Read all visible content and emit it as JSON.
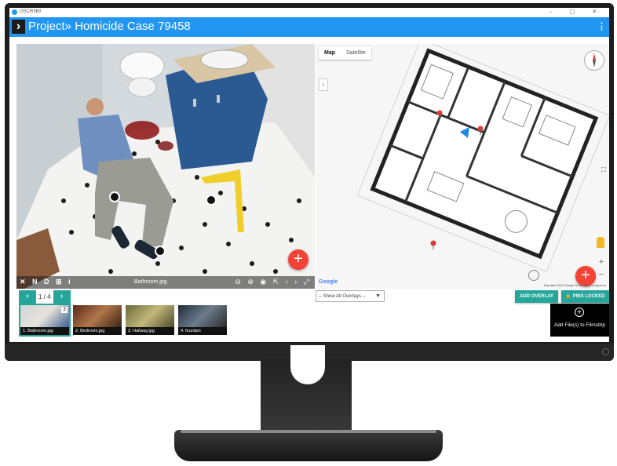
{
  "window": {
    "app_name": "OSCR360",
    "controls": "– ▢ ✕"
  },
  "header": {
    "title": "Project» Homicide Case 79458",
    "menu_icon": "⋮"
  },
  "photo": {
    "tools_left": "✕ N D ⊞ i",
    "filename": "Bathroom.jpg",
    "tools_right": "⊖ ⊕ ◉ ⇱ ‹ › ⤢",
    "add_label": "+"
  },
  "map": {
    "tabs": [
      {
        "label": "Map",
        "active": true
      },
      {
        "label": "Satellite",
        "active": false
      }
    ],
    "collapse": "‹",
    "fullscreen": "⛶",
    "zoom_in": "+",
    "zoom_out": "−",
    "google": "Google",
    "attribution": "Map data ©2024 Google   Terms   Report a map error",
    "add_label": "+"
  },
  "pager": {
    "prev": "‹",
    "text": "1 / 4",
    "next": "›"
  },
  "overlays": {
    "select_label": "-- Show All Overlays --"
  },
  "buttons": {
    "add_overlay": "ADD OVERLAY",
    "pins_locked": "PINS LOCKED"
  },
  "filmstrip": {
    "items": [
      {
        "label": "1. Bathroom.jpg",
        "count": "3",
        "selected": true
      },
      {
        "label": "2. Bedroom.jpg",
        "selected": false
      },
      {
        "label": "3. Hallway.jpg",
        "selected": false
      },
      {
        "label": "4. fountain",
        "selected": false
      }
    ],
    "add_label": "Add File(s) to Filmstrip",
    "add_icon": "+"
  },
  "colors": {
    "header": "#2196f3",
    "accent": "#26a69a",
    "fab": "#f44336"
  }
}
